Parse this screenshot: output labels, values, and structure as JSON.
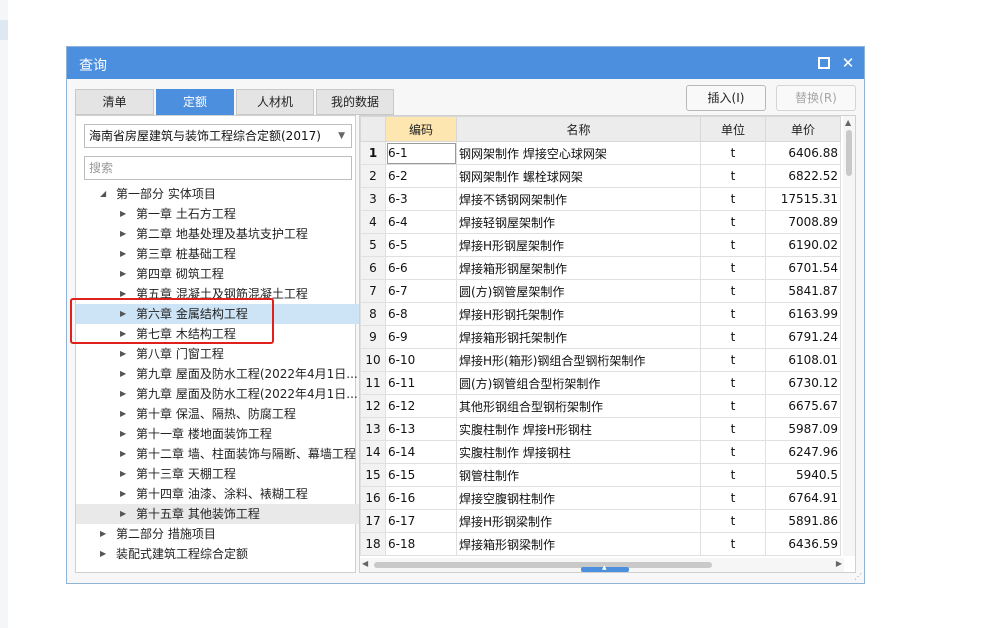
{
  "dialog": {
    "title": "查询",
    "maximize_icon": "maximize-icon",
    "close_icon": "close-icon",
    "close_symbol": "✕"
  },
  "tabs": [
    {
      "label": "清单",
      "active": false
    },
    {
      "label": "定额",
      "active": true
    },
    {
      "label": "人材机",
      "active": false
    },
    {
      "label": "我的数据",
      "active": false
    }
  ],
  "buttons": {
    "insert": "插入(I)",
    "replace": "替换(R)"
  },
  "left": {
    "library_select": "海南省房屋建筑与装饰工程综合定额(2017)",
    "search_placeholder": "搜索",
    "tree": [
      {
        "label": "第一部分 实体项目",
        "level": 0,
        "expanded": true
      },
      {
        "label": "第一章 土石方工程",
        "level": 1
      },
      {
        "label": "第二章 地基处理及基坑支护工程",
        "level": 1
      },
      {
        "label": "第三章 桩基础工程",
        "level": 1
      },
      {
        "label": "第四章 砌筑工程",
        "level": 1
      },
      {
        "label": "第五章 混凝土及钢筋混凝土工程",
        "level": 1
      },
      {
        "label": "第六章 金属结构工程",
        "level": 1,
        "selected": true
      },
      {
        "label": "第七章 木结构工程",
        "level": 1
      },
      {
        "label": "第八章 门窗工程",
        "level": 1
      },
      {
        "label": "第九章 屋面及防水工程(2022年4月1日...",
        "level": 1
      },
      {
        "label": "第九章 屋面及防水工程(2022年4月1日...",
        "level": 1
      },
      {
        "label": "第十章 保温、隔热、防腐工程",
        "level": 1
      },
      {
        "label": "第十一章 楼地面装饰工程",
        "level": 1
      },
      {
        "label": "第十二章 墙、柱面装饰与隔断、幕墙工程",
        "level": 1
      },
      {
        "label": "第十三章 天棚工程",
        "level": 1
      },
      {
        "label": "第十四章 油漆、涂料、裱糊工程",
        "level": 1
      },
      {
        "label": "第十五章 其他装饰工程",
        "level": 1,
        "hover": true
      },
      {
        "label": "第二部分 措施项目",
        "level": 0,
        "expanded": false
      },
      {
        "label": "装配式建筑工程综合定额",
        "level": 0,
        "expanded": false
      }
    ]
  },
  "table": {
    "columns": [
      "编码",
      "名称",
      "单位",
      "单价"
    ],
    "rows": [
      {
        "n": "1",
        "code": "6-1",
        "name": "钢网架制作 焊接空心球网架",
        "unit": "t",
        "price": "6406.88"
      },
      {
        "n": "2",
        "code": "6-2",
        "name": "钢网架制作 螺栓球网架",
        "unit": "t",
        "price": "6822.52"
      },
      {
        "n": "3",
        "code": "6-3",
        "name": "焊接不锈钢网架制作",
        "unit": "t",
        "price": "17515.31"
      },
      {
        "n": "4",
        "code": "6-4",
        "name": "焊接轻钢屋架制作",
        "unit": "t",
        "price": "7008.89"
      },
      {
        "n": "5",
        "code": "6-5",
        "name": "焊接H形钢屋架制作",
        "unit": "t",
        "price": "6190.02"
      },
      {
        "n": "6",
        "code": "6-6",
        "name": "焊接箱形钢屋架制作",
        "unit": "t",
        "price": "6701.54"
      },
      {
        "n": "7",
        "code": "6-7",
        "name": "圆(方)钢管屋架制作",
        "unit": "t",
        "price": "5841.87"
      },
      {
        "n": "8",
        "code": "6-8",
        "name": "焊接H形钢托架制作",
        "unit": "t",
        "price": "6163.99"
      },
      {
        "n": "9",
        "code": "6-9",
        "name": "焊接箱形钢托架制作",
        "unit": "t",
        "price": "6791.24"
      },
      {
        "n": "10",
        "code": "6-10",
        "name": "焊接H形(箱形)钢组合型钢桁架制作",
        "unit": "t",
        "price": "6108.01"
      },
      {
        "n": "11",
        "code": "6-11",
        "name": "圆(方)钢管组合型桁架制作",
        "unit": "t",
        "price": "6730.12"
      },
      {
        "n": "12",
        "code": "6-12",
        "name": "其他形钢组合型钢桁架制作",
        "unit": "t",
        "price": "6675.67"
      },
      {
        "n": "13",
        "code": "6-13",
        "name": "实腹柱制作 焊接H形钢柱",
        "unit": "t",
        "price": "5987.09"
      },
      {
        "n": "14",
        "code": "6-14",
        "name": "实腹柱制作 焊接钢柱",
        "unit": "t",
        "price": "6247.96"
      },
      {
        "n": "15",
        "code": "6-15",
        "name": "钢管柱制作",
        "unit": "t",
        "price": "5940.5"
      },
      {
        "n": "16",
        "code": "6-16",
        "name": "焊接空腹钢柱制作",
        "unit": "t",
        "price": "6764.91"
      },
      {
        "n": "17",
        "code": "6-17",
        "name": "焊接H形钢梁制作",
        "unit": "t",
        "price": "5891.86"
      },
      {
        "n": "18",
        "code": "6-18",
        "name": "焊接箱形钢梁制作",
        "unit": "t",
        "price": "6436.59"
      }
    ]
  },
  "colors": {
    "titlebar": "#4d8fdf",
    "active_tab": "#4d8fdf",
    "selected_row": "#cde4f7",
    "code_header": "#fde6b0",
    "annotation_box": "#e0201b"
  }
}
